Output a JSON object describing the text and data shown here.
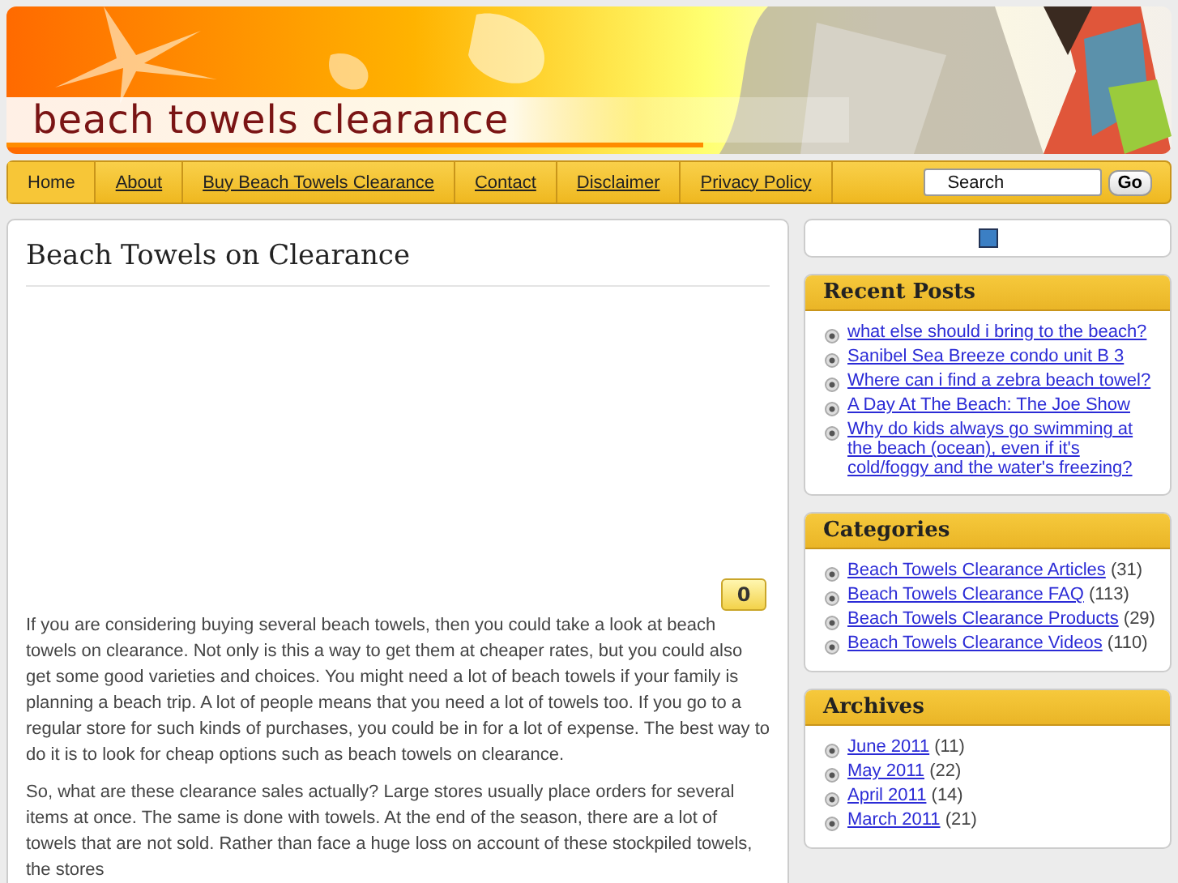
{
  "header": {
    "title": "beach towels clearance"
  },
  "nav": {
    "items": [
      {
        "label": "Home",
        "selected": true
      },
      {
        "label": "About",
        "selected": false
      },
      {
        "label": "Buy Beach Towels Clearance",
        "selected": false
      },
      {
        "label": "Contact",
        "selected": false
      },
      {
        "label": "Disclaimer",
        "selected": false
      },
      {
        "label": "Privacy Policy",
        "selected": false
      }
    ],
    "search": {
      "value": "Search"
    },
    "go_button": "Go"
  },
  "post": {
    "title": "Beach Towels on Clearance",
    "comment_count": "0",
    "paragraphs": [
      "If you are considering buying several beach towels, then you could take a look at beach towels on clearance. Not only is this a way to get them at cheaper rates, but you could also get some good varieties and choices. You might need a lot of beach towels if your family is planning a beach trip. A lot of people means that you need a lot of towels too. If you go to a regular store for such kinds of purchases, you could be in for a lot of expense. The best way to do it is to look for cheap options such as beach towels on clearance.",
      "So, what are these clearance sales actually? Large stores usually place orders for several items at once. The same is done with towels. At the end of the season, there are a lot of towels that are not sold. Rather than face a huge loss on account of these stockpiled towels, the stores"
    ]
  },
  "sidebar": {
    "widgets": [
      {
        "title": "Recent Posts",
        "items": [
          {
            "label": "what else should i bring to the beach?"
          },
          {
            "label": "Sanibel Sea Breeze condo unit B 3"
          },
          {
            "label": "Where can i find a zebra beach towel?"
          },
          {
            "label": "A Day At The Beach: The Joe Show"
          },
          {
            "label": "Why do kids always go swimming at the beach (ocean), even if it's cold/foggy and the water's freezing?"
          }
        ]
      },
      {
        "title": "Categories",
        "items": [
          {
            "label": "Beach Towels Clearance Articles",
            "count": "(31)"
          },
          {
            "label": "Beach Towels Clearance FAQ",
            "count": "(113)"
          },
          {
            "label": "Beach Towels Clearance Products",
            "count": "(29)"
          },
          {
            "label": "Beach Towels Clearance Videos",
            "count": "(110)"
          }
        ]
      },
      {
        "title": "Archives",
        "items": [
          {
            "label": "June 2011",
            "count": "(11)"
          },
          {
            "label": "May 2011",
            "count": "(22)"
          },
          {
            "label": "April 2011",
            "count": "(14)"
          },
          {
            "label": "March 2011",
            "count": "(21)"
          }
        ]
      }
    ]
  }
}
